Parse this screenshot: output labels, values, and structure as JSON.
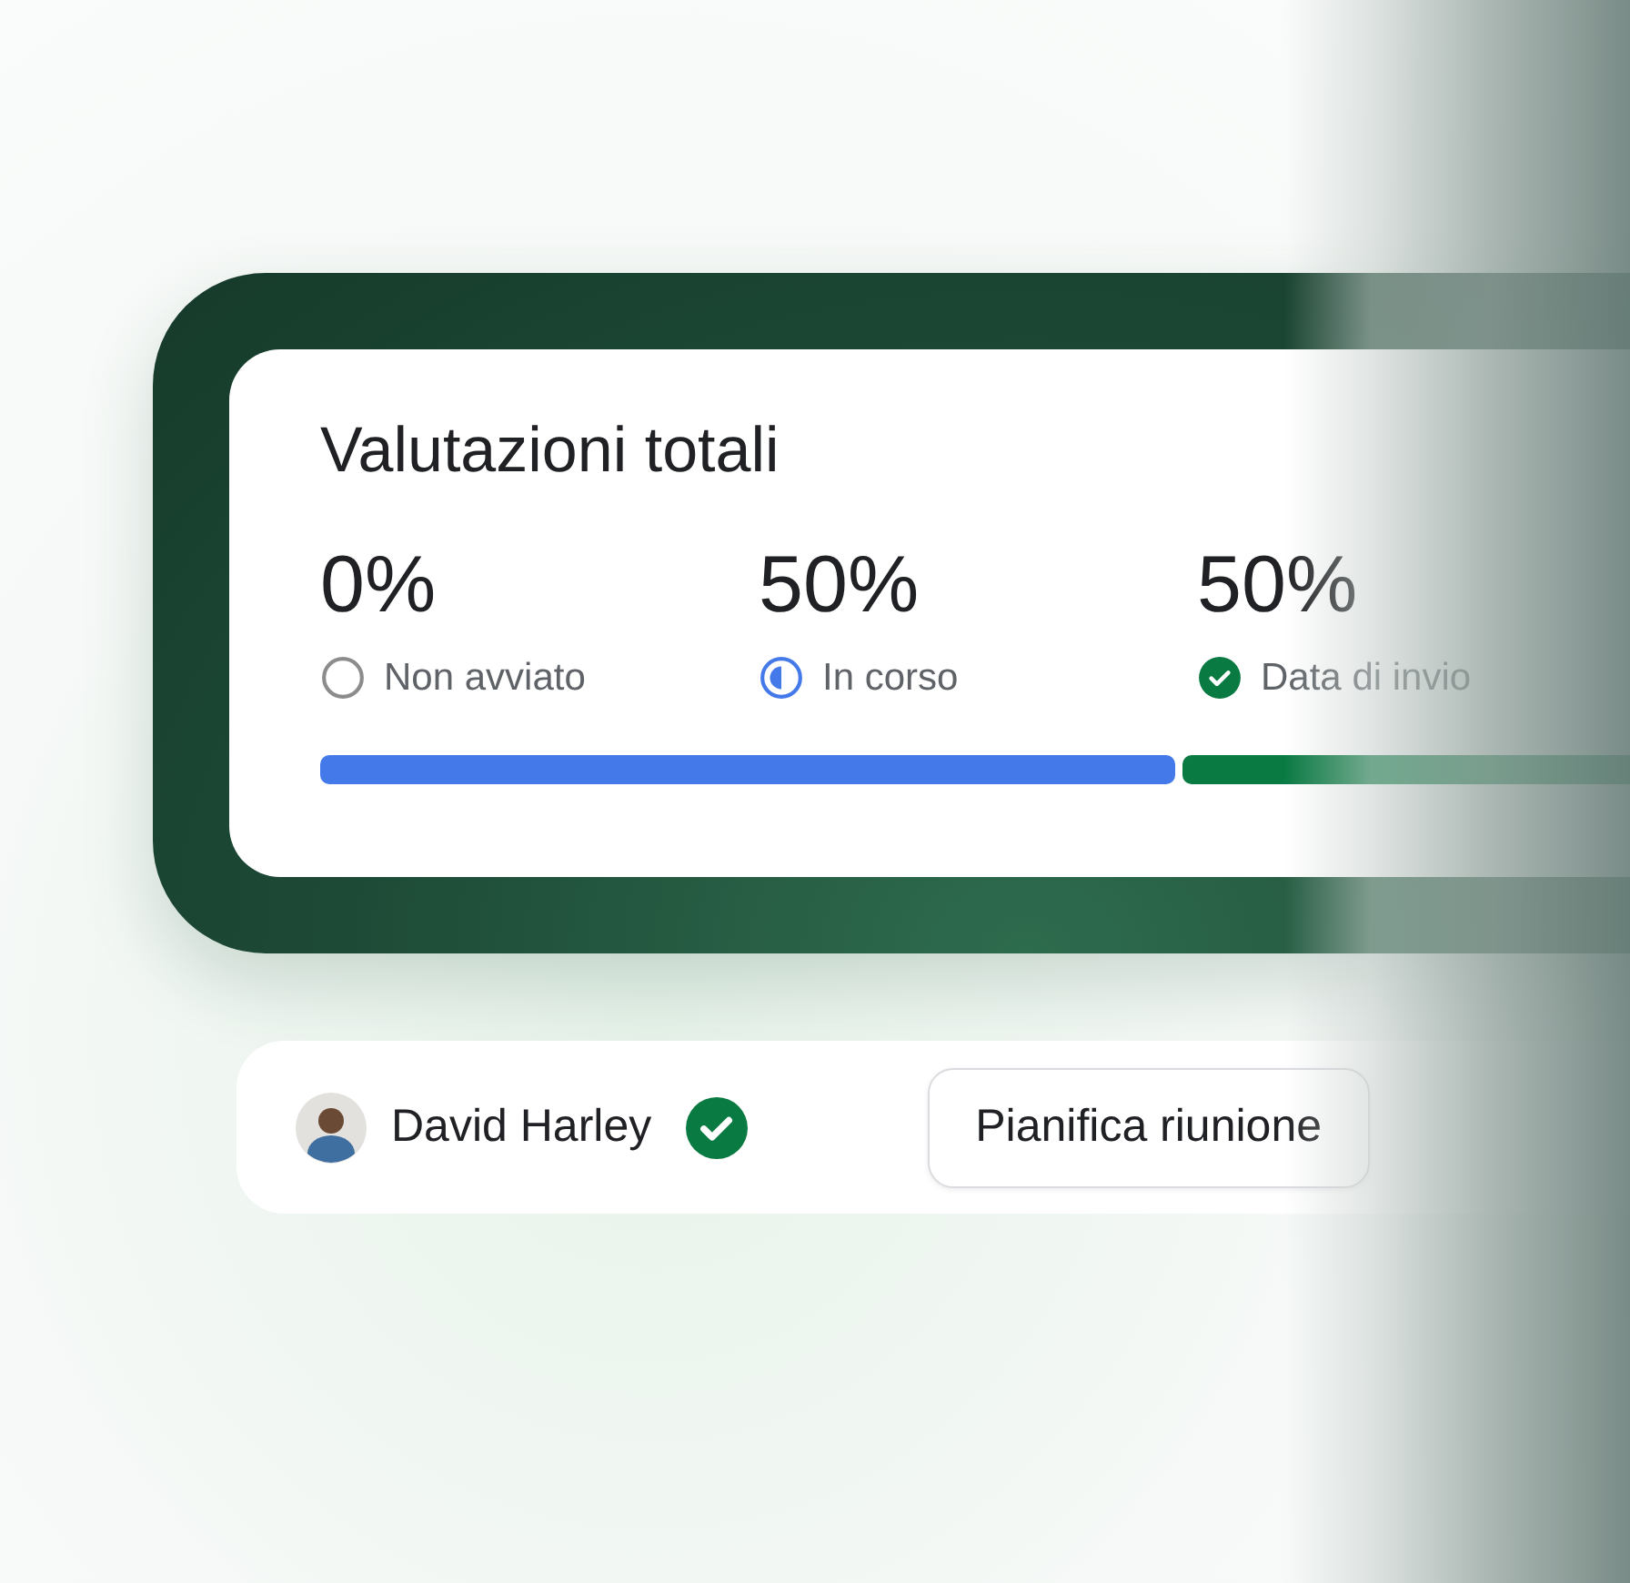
{
  "card": {
    "title": "Valutazioni totali",
    "stats": [
      {
        "value": "0%",
        "label": "Non avviato",
        "kind": "not-started"
      },
      {
        "value": "50%",
        "label": "In corso",
        "kind": "in-progress"
      },
      {
        "value": "50%",
        "label": "Data di invio",
        "kind": "submitted"
      }
    ],
    "progress": [
      {
        "color": "#4479ea"
      },
      {
        "color": "#0a7a43"
      }
    ]
  },
  "person": {
    "name": "David Harley",
    "verified": true,
    "button": "Pianifica riunione"
  }
}
